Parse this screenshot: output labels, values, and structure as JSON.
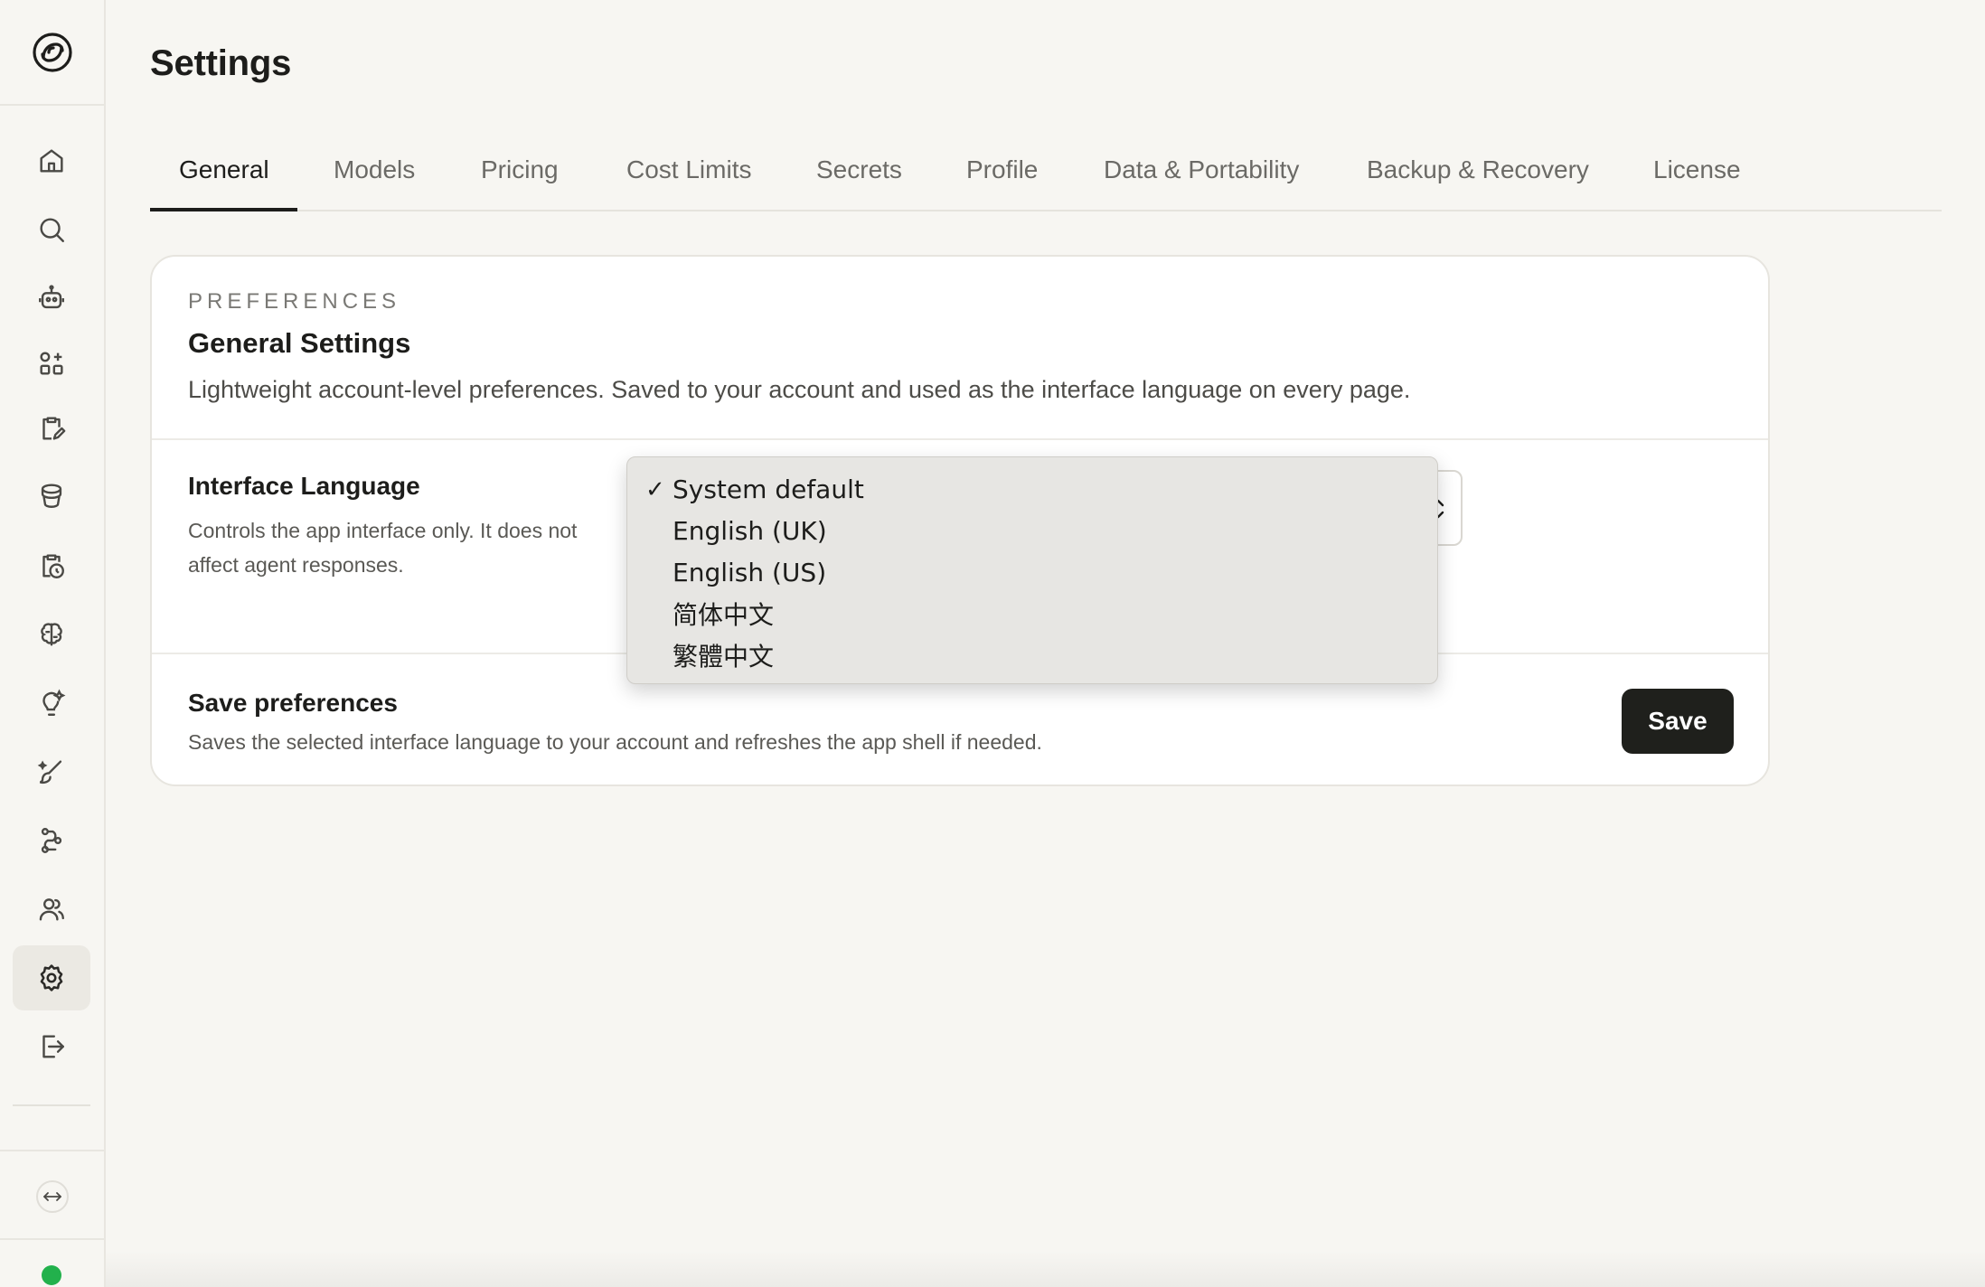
{
  "page": {
    "title": "Settings"
  },
  "tabs": [
    {
      "label": "General",
      "active": true
    },
    {
      "label": "Models"
    },
    {
      "label": "Pricing"
    },
    {
      "label": "Cost Limits"
    },
    {
      "label": "Secrets"
    },
    {
      "label": "Profile"
    },
    {
      "label": "Data & Portability"
    },
    {
      "label": "Backup & Recovery"
    },
    {
      "label": "License"
    }
  ],
  "sidebar": {
    "icons": [
      "logo-icon",
      "home-icon",
      "search-icon",
      "robot-icon",
      "apps-icon",
      "clipboard-edit-icon",
      "stack-icon",
      "clipboard-clock-icon",
      "brain-icon",
      "lightbulb-icon",
      "sparkle-brush-icon",
      "workflow-icon",
      "users-icon",
      "gear-icon",
      "logout-icon",
      "expand-icon"
    ],
    "active": "gear-icon",
    "status_color": "#22b14c"
  },
  "card": {
    "eyebrow": "PREFERENCES",
    "title": "General Settings",
    "description": "Lightweight account-level preferences. Saved to your account and used as the interface language on every page.",
    "language": {
      "title": "Interface Language",
      "description_line1": "Controls the app interface only. It does not",
      "description_line2": "affect agent responses.",
      "selected": "System default",
      "options": [
        "System default",
        "English (UK)",
        "English (US)",
        "简体中文",
        "繁體中文"
      ]
    },
    "save": {
      "title": "Save preferences",
      "description": "Saves the selected interface language to your account and refreshes the app shell if needed.",
      "button_label": "Save"
    }
  },
  "colors": {
    "background": "#f7f6f2",
    "primary_button": "#1f201c",
    "status_online": "#22b14c"
  }
}
